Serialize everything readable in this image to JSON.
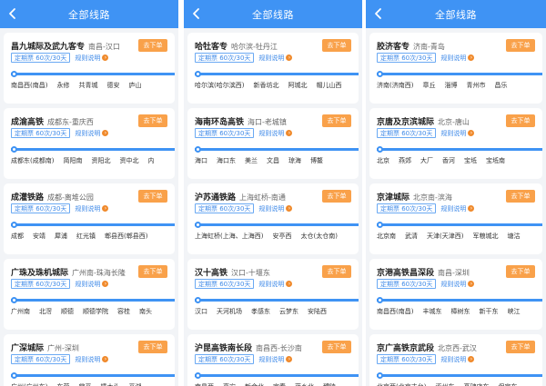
{
  "colors": {
    "header": "#3f93f4",
    "buy": "#f9a14a",
    "tag": "#3f8ae8",
    "rule_dot": "#f08a2c"
  },
  "phones": [
    {
      "title": "全部线路",
      "cards": [
        {
          "name": "昌九城际及武九客专",
          "route": "南昌-汉口",
          "buy": "去下单",
          "tag": "定期票 60次/30天",
          "rule": "规则说明",
          "stations": [
            "南昌西(南昌)",
            "永修",
            "共青城",
            "德安",
            "庐山"
          ]
        },
        {
          "name": "成渝高铁",
          "route": "成都东-重庆西",
          "buy": "去下单",
          "tag": "定期票 60次/30天",
          "rule": "规则说明",
          "stations": [
            "成都东(成都南)",
            "简阳南",
            "资阳北",
            "资中北",
            "内"
          ]
        },
        {
          "name": "成灌铁路",
          "route": "成都-离堆公园",
          "buy": "去下单",
          "tag": "定期票 60次/30天",
          "rule": "规则说明",
          "stations": [
            "成都",
            "安靖",
            "犀浦",
            "红光镇",
            "郫县西(郫县西)"
          ]
        },
        {
          "name": "广珠及珠机城际",
          "route": "广州南-珠海长隆",
          "buy": "去下单",
          "tag": "定期票 60次/30天",
          "rule": "规则说明",
          "stations": [
            "广州南",
            "北滘",
            "顺德",
            "顺德学院",
            "容桂",
            "南头"
          ]
        },
        {
          "name": "广深城际",
          "route": "广州-深圳",
          "buy": "去下单",
          "tag": "定期票 60次/30天",
          "rule": "规则说明",
          "stations": [
            "广州(广州东)",
            "东莞",
            "常平",
            "樟木头",
            "平湖"
          ]
        }
      ]
    },
    {
      "title": "全部线路",
      "cards": [
        {
          "name": "哈牡客专",
          "route": "哈尔滨-牡丹江",
          "buy": "去下单",
          "tag": "定期票 60次/30天",
          "rule": "规则说明",
          "stations": [
            "哈尔滨(哈尔滨西)",
            "新香坊北",
            "阿城北",
            "帽儿山西"
          ]
        },
        {
          "name": "海南环岛高铁",
          "route": "海口-老城镇",
          "buy": "去下单",
          "tag": "定期票 60次/30天",
          "rule": "规则说明",
          "stations": [
            "海口",
            "海口东",
            "美兰",
            "文昌",
            "琼海",
            "博鳌"
          ]
        },
        {
          "name": "沪苏通铁路",
          "route": "上海虹桥-南通",
          "buy": "去下单",
          "tag": "定期票 60次/30天",
          "rule": "规则说明",
          "stations": [
            "上海虹桥(上海、上海西)",
            "安亭西",
            "太仓(太仓南)"
          ]
        },
        {
          "name": "汉十高铁",
          "route": "汉口-十堰东",
          "buy": "去下单",
          "tag": "定期票 60次/30天",
          "rule": "规则说明",
          "stations": [
            "汉口",
            "天河机场",
            "孝感东",
            "云梦东",
            "安陆西"
          ]
        },
        {
          "name": "沪昆高铁南长段",
          "route": "南昌西-长沙南",
          "buy": "去下单",
          "tag": "定期票 60次/30天",
          "rule": "规则说明",
          "stations": [
            "南昌西",
            "高安",
            "新余北",
            "宜春",
            "萍乡北",
            "醴陵"
          ]
        }
      ]
    },
    {
      "title": "全部线路",
      "cards": [
        {
          "name": "胶济客专",
          "route": "济南-青岛",
          "buy": "去下单",
          "tag": "定期票 60次/30天",
          "rule": "规则说明",
          "stations": [
            "济南(济南西)",
            "章丘",
            "淄博",
            "青州市",
            "昌乐"
          ]
        },
        {
          "name": "京唐及京滨城际",
          "route": "北京-唐山",
          "buy": "去下单",
          "tag": "定期票 60次/30天",
          "rule": "规则说明",
          "stations": [
            "北京",
            "燕郊",
            "大厂",
            "香河",
            "宝坻",
            "宝坻南"
          ]
        },
        {
          "name": "京津城际",
          "route": "北京南-滨海",
          "buy": "去下单",
          "tag": "定期票 60次/30天",
          "rule": "规则说明",
          "stations": [
            "北京南",
            "武清",
            "天津(天津西)",
            "军粮城北",
            "塘沽"
          ]
        },
        {
          "name": "京港高铁昌深段",
          "route": "南昌-深圳",
          "buy": "去下单",
          "tag": "定期票 60次/30天",
          "rule": "规则说明",
          "stations": [
            "南昌西(南昌)",
            "丰城东",
            "樟树东",
            "新干东",
            "峡江"
          ]
        },
        {
          "name": "京广高铁京武段",
          "route": "北京西-武汉",
          "buy": "去下单",
          "tag": "定期票 60次/30天",
          "rule": "规则说明",
          "stations": [
            "北京西(北京丰台)",
            "涿州东",
            "高碑店东",
            "保定东"
          ]
        }
      ]
    }
  ]
}
